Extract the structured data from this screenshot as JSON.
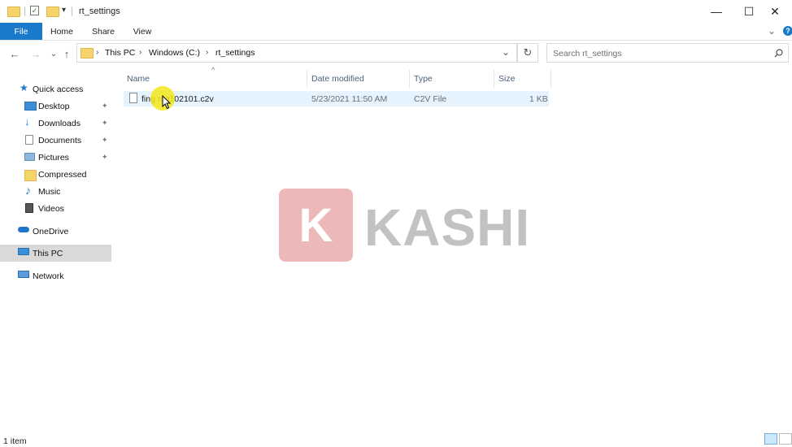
{
  "window": {
    "title": "rt_settings",
    "minimize_glyph": "—",
    "maximize_glyph": "☐",
    "close_glyph": "✕"
  },
  "ribbon": {
    "tabs": [
      "File",
      "Home",
      "Share",
      "View"
    ],
    "collapse_glyph": "⌄",
    "help_glyph": "?"
  },
  "address": {
    "breadcrumbs": [
      "This PC",
      "Windows (C:)",
      "rt_settings"
    ],
    "dropdown_glyph": "⌄",
    "refresh_glyph": "↻"
  },
  "search": {
    "placeholder": "Search rt_settings",
    "icon": "search-icon"
  },
  "nav_buttons": {
    "back": "←",
    "forward": "→",
    "recent": "⌄",
    "up": "↑"
  },
  "sidebar": {
    "items": [
      {
        "label": "Quick access",
        "icon": "star-icon",
        "pinned": false
      },
      {
        "label": "Desktop",
        "icon": "desktop-icon",
        "pinned": true
      },
      {
        "label": "Downloads",
        "icon": "download-icon",
        "pinned": true
      },
      {
        "label": "Documents",
        "icon": "documents-icon",
        "pinned": true
      },
      {
        "label": "Pictures",
        "icon": "pictures-icon",
        "pinned": true
      },
      {
        "label": "Compressed",
        "icon": "folder-icon",
        "pinned": false
      },
      {
        "label": "Music",
        "icon": "music-icon",
        "pinned": false
      },
      {
        "label": "Videos",
        "icon": "videos-icon",
        "pinned": false
      },
      {
        "label": "OneDrive",
        "icon": "cloud-icon",
        "pinned": false
      },
      {
        "label": "This PC",
        "icon": "computer-icon",
        "pinned": false,
        "selected": true
      },
      {
        "label": "Network",
        "icon": "network-icon",
        "pinned": false
      }
    ],
    "pin_glyph": "📌"
  },
  "columns": {
    "name": "Name",
    "date_modified": "Date modified",
    "type": "Type",
    "size": "Size",
    "sort_glyph": "^"
  },
  "files": [
    {
      "name": "fing ntg102101.c2v",
      "date_modified": "5/23/2021 11:50 AM",
      "type": "C2V File",
      "size": "1 KB"
    }
  ],
  "watermark": {
    "logo_letter": "K",
    "text": "KASHI"
  },
  "status": {
    "item_count": "1 item"
  },
  "colors": {
    "file_tab": "#1979ca",
    "selection": "#e5f3ff",
    "sidebar_selected": "#d9d9d9",
    "folder": "#f7d46b"
  }
}
